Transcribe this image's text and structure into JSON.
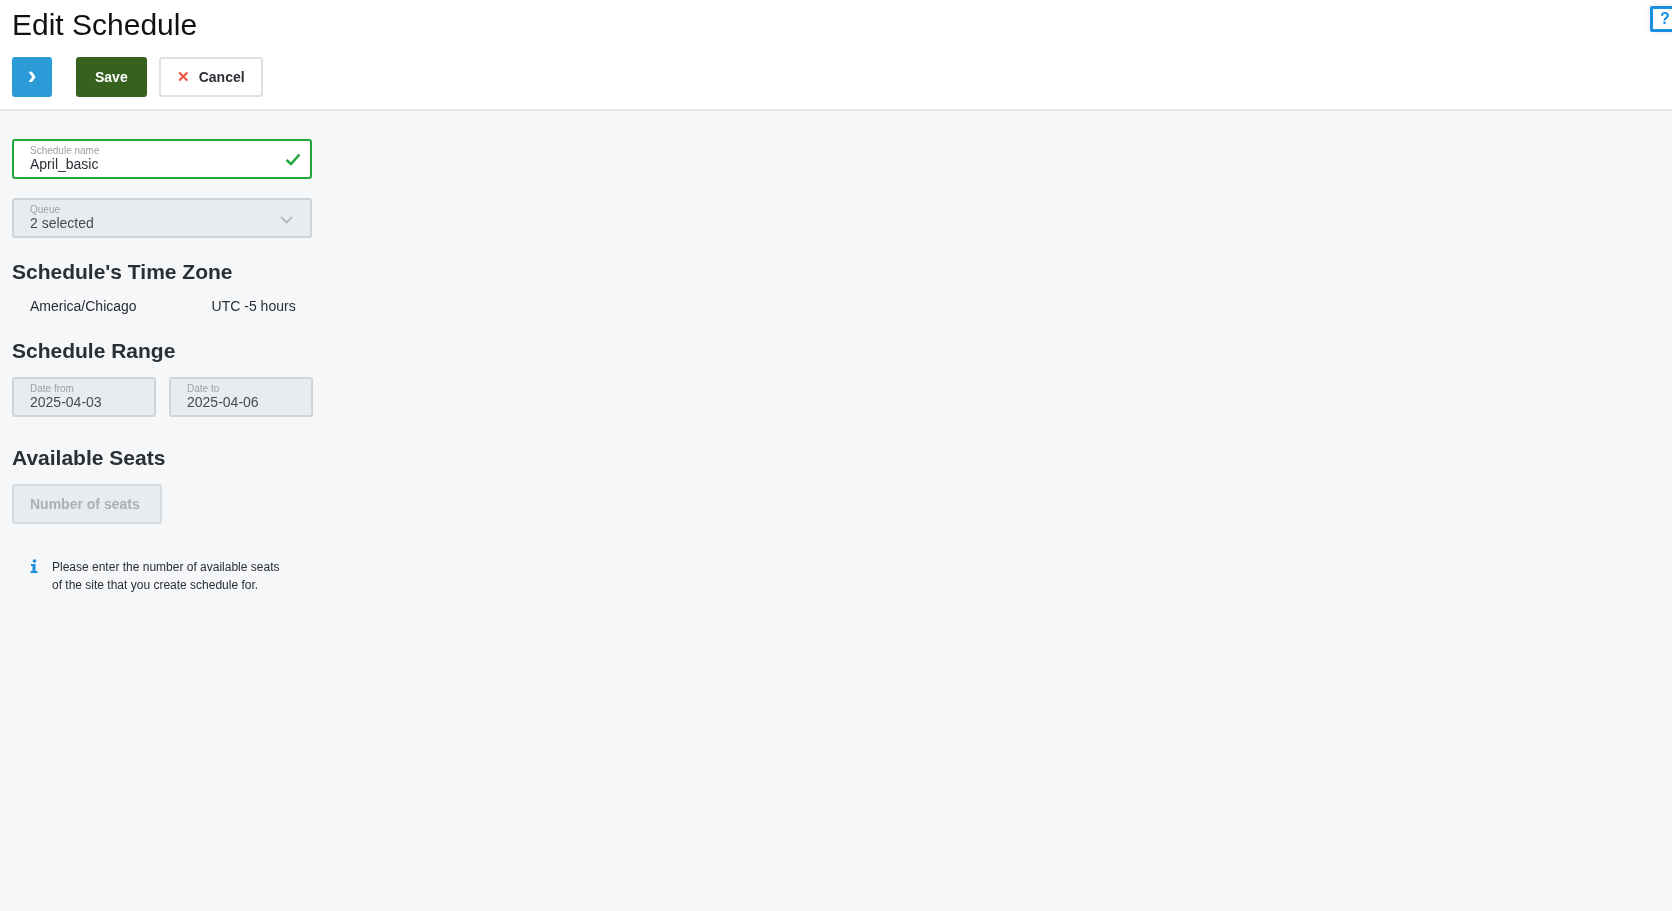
{
  "page": {
    "title": "Edit Schedule"
  },
  "help_button": {
    "label": "?"
  },
  "toolbar": {
    "expand_label": "›",
    "save": "Save",
    "cancel_icon": "✕",
    "cancel": "Cancel"
  },
  "schedule_name": {
    "label": "Schedule name",
    "value": "April_basic",
    "valid": true,
    "disabled": false
  },
  "queue": {
    "label": "Queue",
    "value": "2 selected",
    "disabled": true
  },
  "time_zone": {
    "heading": "Schedule's Time Zone",
    "zone": "America/Chicago",
    "offset": "UTC -5 hours"
  },
  "range": {
    "heading": "Schedule Range",
    "fields": [
      {
        "label": "Date from",
        "value": "2025-04-03",
        "disabled": true
      },
      {
        "label": "Date to",
        "value": "2025-04-06",
        "disabled": true
      }
    ]
  },
  "seats": {
    "heading": "Available Seats",
    "placeholder": "Number of seats",
    "disabled": true,
    "info": "Please enter the number of available seats of the site that you create schedule for."
  }
}
